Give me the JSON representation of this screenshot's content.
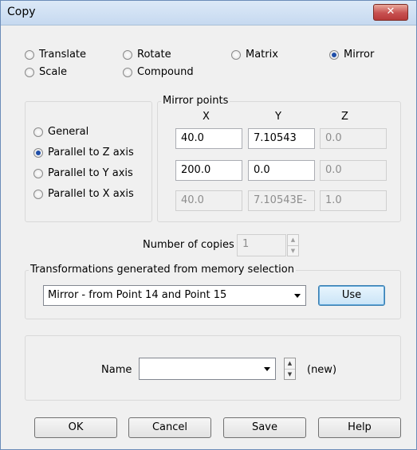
{
  "window": {
    "title": "Copy",
    "close_icon": "close-icon"
  },
  "transform_types": [
    {
      "label": "Translate",
      "selected": false
    },
    {
      "label": "Rotate",
      "selected": false
    },
    {
      "label": "Matrix",
      "selected": false
    },
    {
      "label": "Mirror",
      "selected": true
    },
    {
      "label": "Scale",
      "selected": false
    },
    {
      "label": "Compound",
      "selected": false
    }
  ],
  "mirror_points": {
    "title": "Mirror points",
    "col_x": "X",
    "col_y": "Y",
    "col_z": "Z",
    "modes": [
      {
        "label": "General",
        "selected": false
      },
      {
        "label": "Parallel to Z axis",
        "selected": true
      },
      {
        "label": "Parallel to Y axis",
        "selected": false
      },
      {
        "label": "Parallel to X axis",
        "selected": false
      }
    ],
    "rows": [
      {
        "x": "40.0",
        "y": "7.10543",
        "z": "0.0"
      },
      {
        "x": "200.0",
        "y": "0.0",
        "z": "0.0"
      },
      {
        "x": "40.0",
        "y": "7.10543E-",
        "z": "1.0"
      }
    ]
  },
  "copies": {
    "label": "Number of copies",
    "value": "1"
  },
  "memory": {
    "title": "Transformations generated from memory selection",
    "selected": "Mirror - from Point 14 and Point 15",
    "use_label": "Use"
  },
  "name_section": {
    "label": "Name",
    "value": "",
    "status": "(new)"
  },
  "buttons": {
    "ok": "OK",
    "cancel": "Cancel",
    "save": "Save",
    "help": "Help"
  }
}
